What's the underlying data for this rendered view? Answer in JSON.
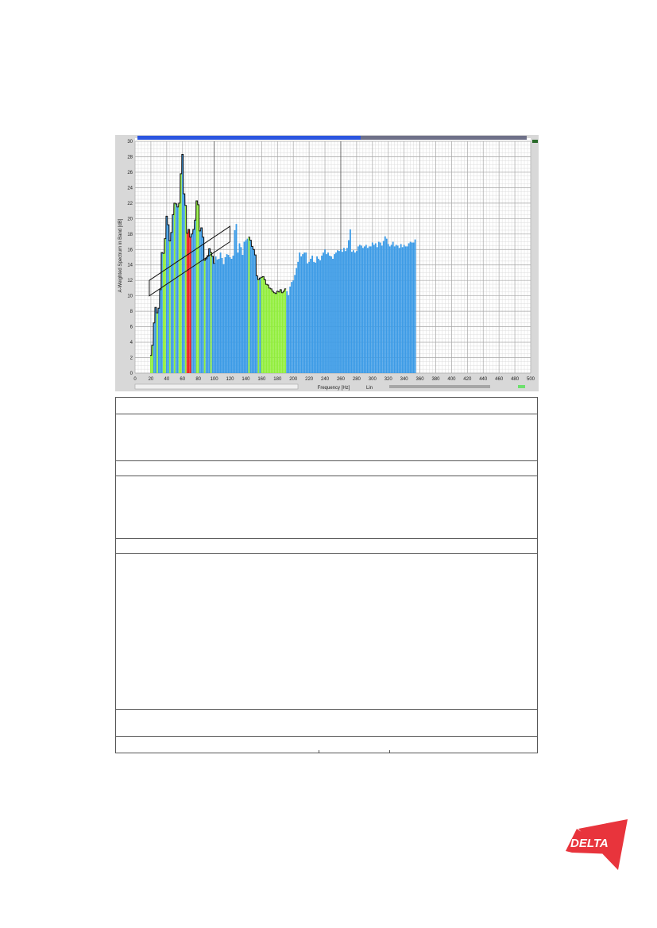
{
  "chart_data": {
    "type": "bar",
    "xlabel": "Frequency [Hz]",
    "ylabel": "A-Weighted Spectrum in Band [dB]",
    "xlim": [
      0,
      500
    ],
    "ylim": [
      0,
      30
    ],
    "xticks": [
      "0",
      "20",
      "40",
      "60",
      "80",
      "100",
      "120",
      "140",
      "160",
      "180",
      "200",
      "220",
      "240",
      "260",
      "280",
      "300",
      "320",
      "340",
      "360",
      "380",
      "400",
      "420",
      "440",
      "460",
      "480",
      "500"
    ],
    "yticks": [
      "0",
      "2",
      "4",
      "6",
      "8",
      "10",
      "12",
      "14",
      "16",
      "18",
      "20",
      "22",
      "24",
      "26",
      "28",
      "30"
    ],
    "scale_label": "Lin",
    "x": [
      20,
      22,
      24,
      26,
      28,
      30,
      32,
      34,
      36,
      38,
      40,
      42,
      44,
      46,
      48,
      50,
      52,
      54,
      56,
      58,
      60,
      62,
      64,
      66,
      68,
      70,
      72,
      74,
      76,
      78,
      80,
      82,
      84,
      86,
      88,
      90,
      92,
      94,
      96,
      98,
      100,
      102,
      104,
      106,
      108,
      110,
      112,
      114,
      116,
      118,
      120,
      122,
      124,
      126,
      128,
      130,
      132,
      134,
      136,
      138,
      140,
      142,
      144,
      146,
      148,
      150,
      152,
      154,
      156,
      158,
      160,
      162,
      164,
      166,
      168,
      170,
      172,
      174,
      176,
      178,
      180,
      182,
      184,
      186,
      188,
      190,
      192,
      194,
      196,
      198,
      200,
      202,
      204,
      206,
      208,
      210,
      212,
      214,
      216,
      218,
      220,
      222,
      224,
      226,
      228,
      230,
      232,
      234,
      236,
      238,
      240,
      242,
      244,
      246,
      248,
      250,
      252,
      254,
      256,
      258,
      260,
      262,
      264,
      266,
      268,
      270,
      272,
      274,
      276,
      278,
      280,
      282,
      284,
      286,
      288,
      290,
      292,
      294,
      296,
      298,
      300,
      302,
      304,
      306,
      308,
      310,
      312,
      314,
      316,
      318,
      320,
      322,
      324,
      326,
      328,
      330,
      332,
      334,
      336,
      338,
      340,
      342,
      344,
      346,
      348,
      350,
      352,
      354,
      356,
      358,
      360,
      362,
      364,
      366,
      368,
      370,
      372,
      374,
      376,
      378,
      380,
      382,
      384,
      386,
      388,
      390,
      392,
      394,
      396,
      398,
      400,
      402,
      404,
      406,
      408,
      410,
      412,
      414,
      416,
      418,
      420,
      422,
      424,
      426,
      428,
      430,
      432,
      434,
      436,
      438,
      440,
      442,
      444,
      446,
      448,
      450,
      452,
      454,
      456,
      458,
      460,
      462,
      464,
      466,
      468,
      470,
      472,
      474,
      476,
      478,
      480,
      482,
      484,
      486,
      488,
      490,
      492,
      494,
      496,
      498,
      500
    ],
    "values": [
      2.3,
      3.6,
      6.5,
      8.5,
      7.8,
      8.4,
      10.8,
      15.6,
      15.5,
      17.4,
      20.3,
      19.2,
      17.1,
      18.2,
      20.5,
      22.0,
      21.9,
      21.5,
      22.0,
      25.8,
      28.3,
      23.2,
      21.7,
      18.1,
      18.6,
      17.6,
      18.0,
      18.6,
      19.8,
      22.3,
      21.8,
      18.4,
      18.8,
      17.6,
      14.6,
      14.8,
      15.2,
      16.1,
      15.6,
      15.1,
      14.2,
      15.1,
      14.7,
      14.8,
      15.6,
      14.9,
      14.1,
      15.0,
      15.4,
      15.3,
      15.0,
      14.8,
      15.2,
      18.5,
      19.3,
      15.6,
      16.8,
      16.3,
      15.3,
      17.0,
      17.2,
      17.4,
      17.6,
      17.2,
      16.4,
      16.0,
      15.3,
      12.6,
      12.1,
      12.3,
      12.4,
      12.5,
      12.1,
      11.5,
      11.4,
      11.0,
      10.9,
      10.6,
      10.4,
      10.3,
      10.6,
      10.5,
      10.8,
      10.4,
      10.6,
      10.9,
      10.6,
      10.1,
      11.2,
      11.8,
      12.0,
      12.7,
      13.6,
      14.4,
      15.6,
      15.1,
      15.4,
      15.6,
      15.6,
      14.2,
      14.4,
      14.8,
      15.2,
      14.4,
      14.3,
      15.1,
      14.8,
      14.6,
      15.2,
      15.6,
      16.0,
      15.4,
      15.6,
      15.2,
      15.1,
      14.8,
      15.4,
      15.6,
      15.9,
      15.8,
      16.0,
      15.7,
      16.2,
      15.8,
      16.2,
      17.2,
      18.6,
      15.7,
      15.9,
      15.6,
      15.8,
      16.4,
      16.6,
      16.5,
      16.2,
      16.4,
      16.6,
      16.2,
      16.4,
      16.4,
      16.9,
      16.6,
      16.8,
      16.3,
      17.0,
      16.9,
      16.5,
      17.1,
      17.7,
      17.4,
      16.7,
      16.4,
      16.6,
      17.0,
      16.4,
      16.6,
      16.5,
      16.2,
      16.7,
      16.3,
      16.6,
      16.4,
      16.4,
      16.8,
      17.0,
      16.9,
      16.9,
      17.3
    ],
    "colors": {
      "base": "#3c9be6",
      "highlight": "#90ee3a",
      "peak": "#ee1c1c",
      "outline": "#111111",
      "scrollbar_top": "#2b55e0"
    }
  },
  "table": {
    "rows": [
      "",
      "",
      "",
      "",
      "",
      "",
      "",
      ""
    ]
  },
  "logo": {
    "text": "DELTA",
    "color": "#e8343c"
  }
}
